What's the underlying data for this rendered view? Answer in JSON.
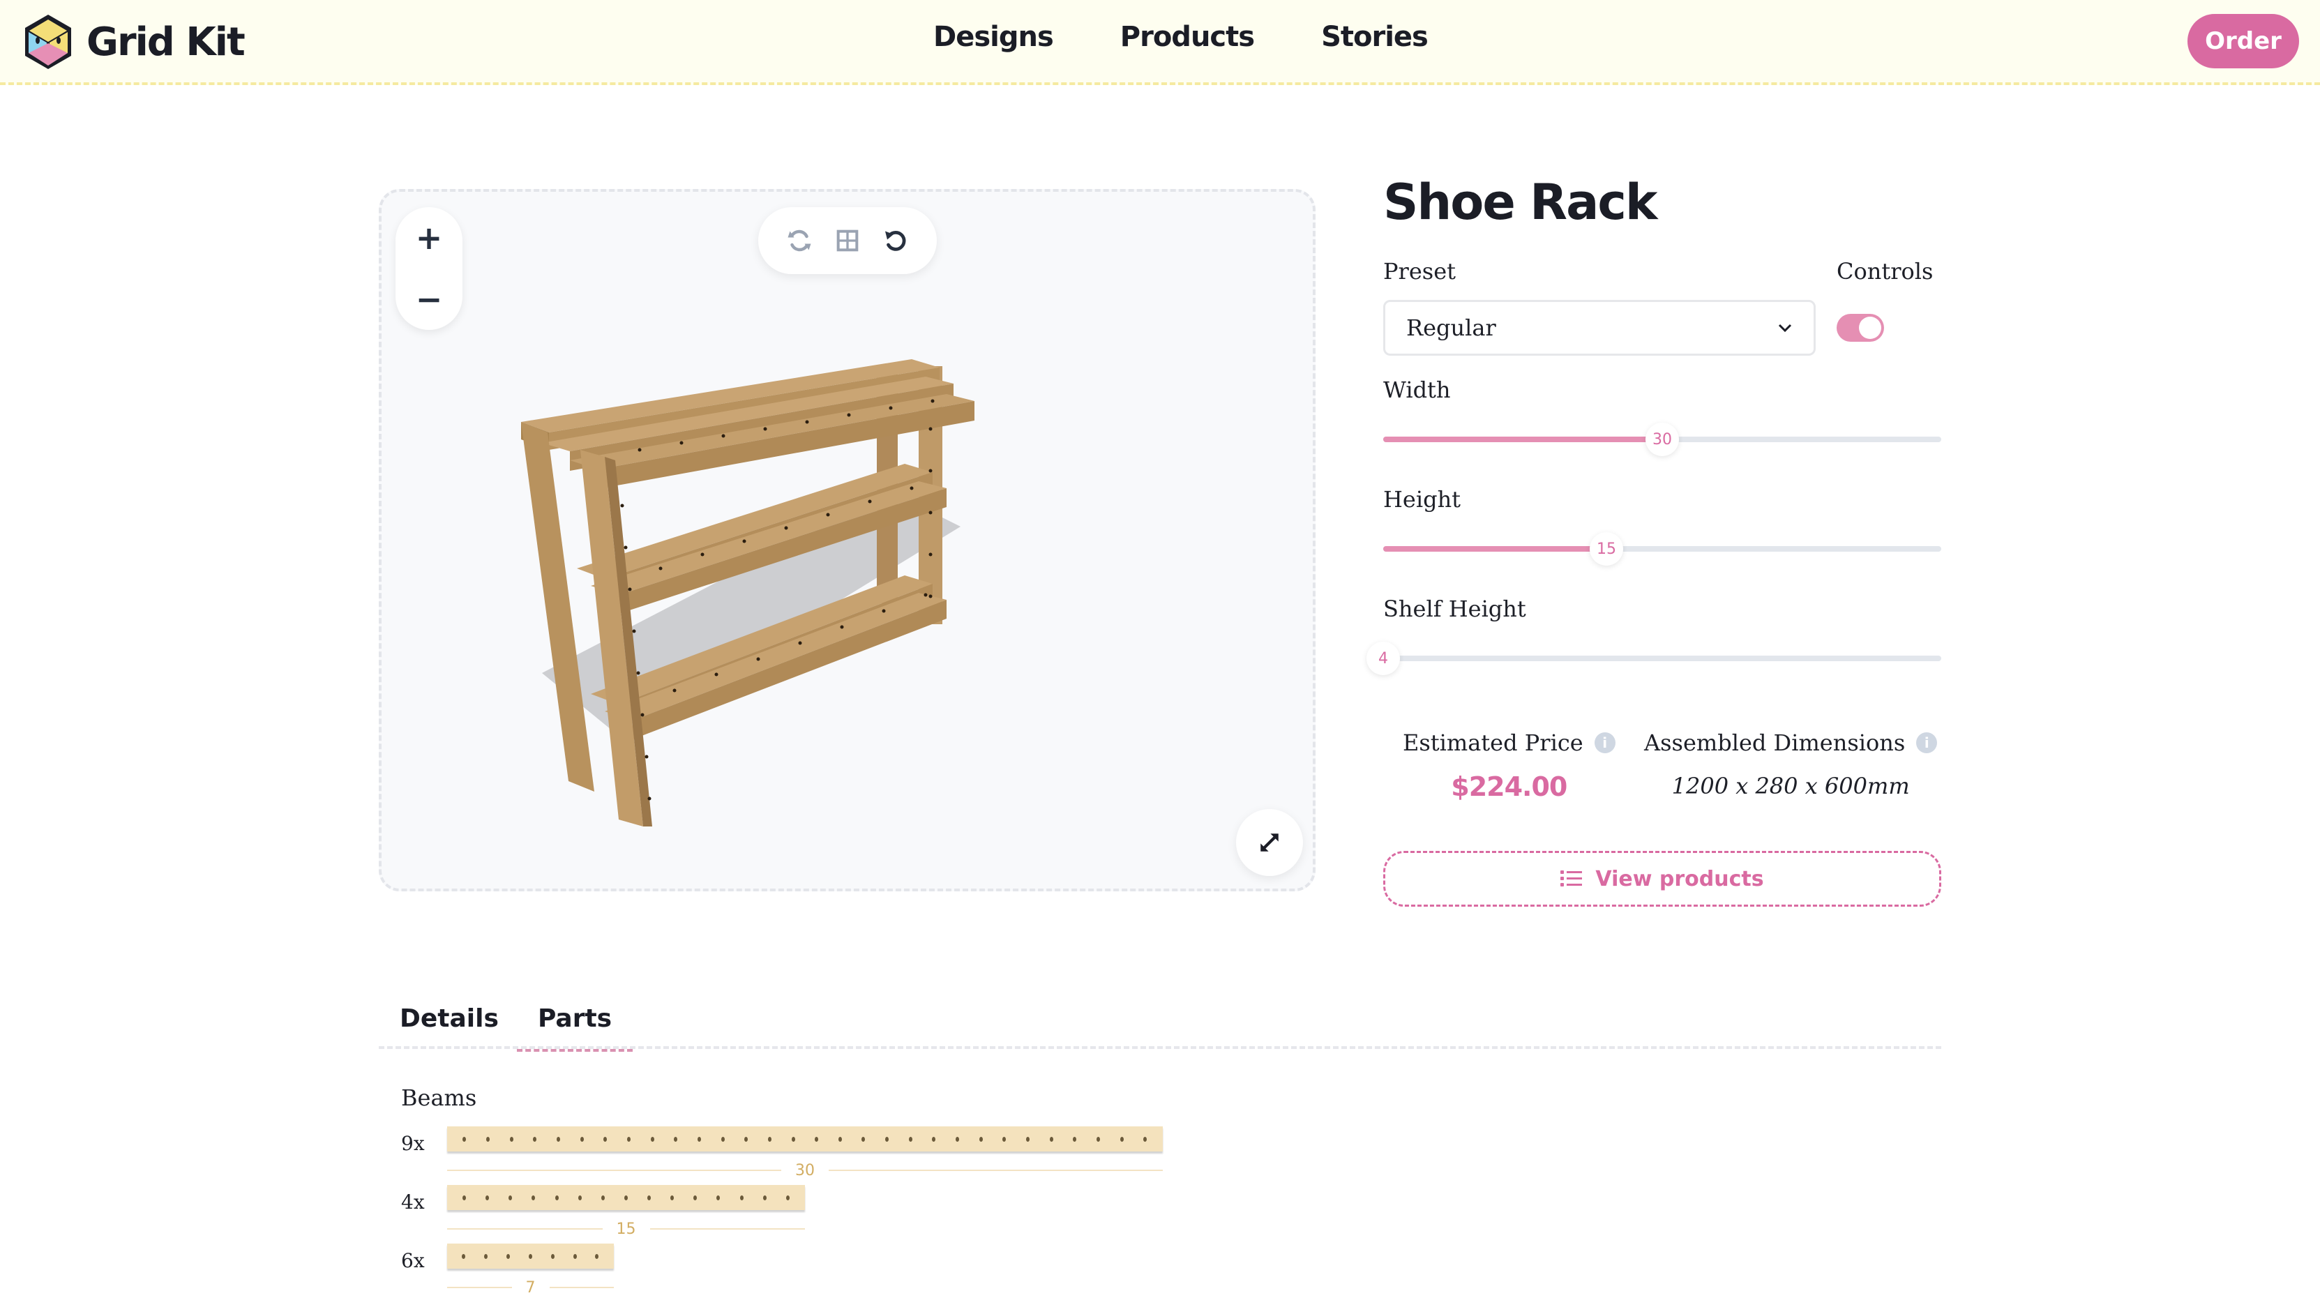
{
  "header": {
    "brand": "Grid Kit",
    "nav": [
      "Designs",
      "Products",
      "Stories"
    ],
    "order_label": "Order"
  },
  "viewer": {
    "zoom_in_icon": "plus-icon",
    "zoom_out_icon": "minus-icon",
    "tools": [
      "rotate-icon",
      "grid-icon",
      "reset-icon"
    ],
    "fullscreen_icon": "expand-icon"
  },
  "product": {
    "title": "Shoe Rack",
    "preset_label": "Preset",
    "preset_value": "Regular",
    "controls_label": "Controls",
    "controls_on": true,
    "sliders": [
      {
        "label": "Width",
        "value": "30",
        "fraction": 0.5
      },
      {
        "label": "Height",
        "value": "15",
        "fraction": 0.4
      },
      {
        "label": "Shelf Height",
        "value": "4",
        "fraction": 0.0
      }
    ],
    "price_label": "Estimated Price",
    "price": "$224.00",
    "dims_label": "Assembled Dimensions",
    "dims": "1200 x 280 x 600mm",
    "view_products_label": "View products"
  },
  "tabs": {
    "items": [
      "Details",
      "Parts"
    ],
    "active": "Parts"
  },
  "parts": {
    "section_title": "Beams",
    "beams": [
      {
        "qty": "9x",
        "length": "30",
        "holes": 30
      },
      {
        "qty": "4x",
        "length": "15",
        "holes": 15
      },
      {
        "qty": "6x",
        "length": "7",
        "holes": 7
      }
    ]
  },
  "colors": {
    "accent": "#d96aa1",
    "accent_light": "#e58fb3",
    "header_bg": "#fefef0",
    "beam": "#f4e2bd"
  }
}
